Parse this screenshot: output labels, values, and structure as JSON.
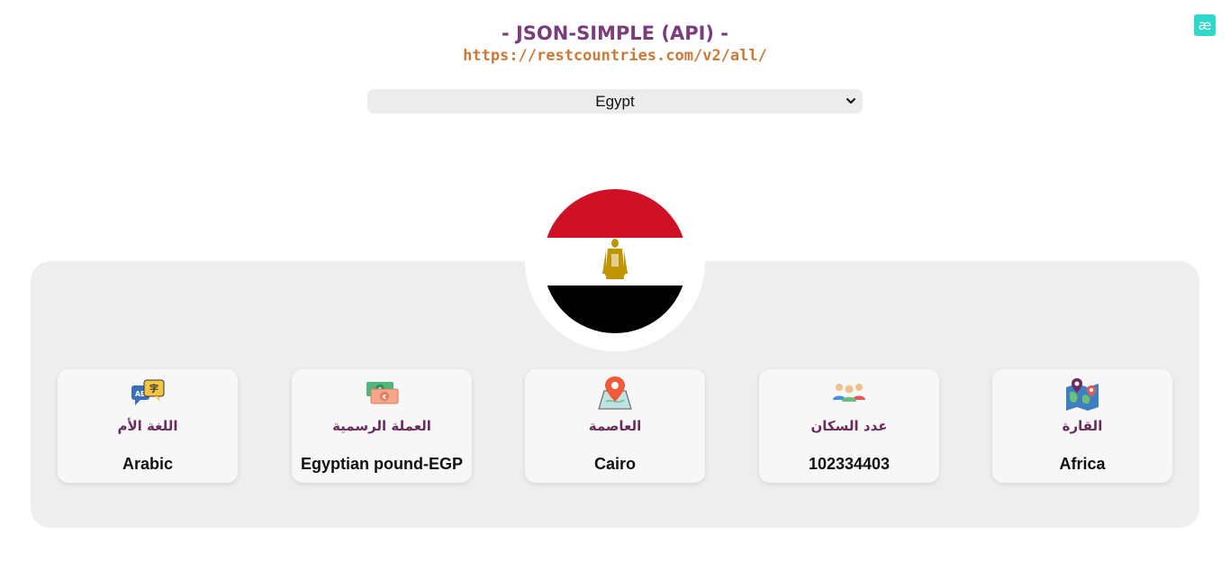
{
  "badge": {
    "text": "æ"
  },
  "header": {
    "title": "- JSON-SIMPLE (API) -",
    "api_url": "https://restcountries.com/v2/all/"
  },
  "country_select": {
    "selected": "Egypt"
  },
  "flag": {
    "country": "Egypt",
    "colors": {
      "top": "#ce1126",
      "middle": "#ffffff",
      "bottom": "#000000",
      "emblem": "#c09300"
    }
  },
  "cards": [
    {
      "label": "اللغة الأم",
      "value": "Arabic",
      "icon": "language-chat-icon"
    },
    {
      "label": "العملة الرسمية",
      "value": "Egyptian pound-EGP",
      "icon": "money-icon"
    },
    {
      "label": "العاصمة",
      "value": "Cairo",
      "icon": "map-pin-icon"
    },
    {
      "label": "عدد السكان",
      "value": "102334403",
      "icon": "people-icon"
    },
    {
      "label": "القارة",
      "value": "Africa",
      "icon": "continent-map-icon"
    }
  ],
  "colors": {
    "title": "#7a3d7c",
    "url": "#cc7a3a",
    "label": "#6a2c5f",
    "panel": "#eeeeee",
    "accent_badge": "#2fd8c8"
  }
}
